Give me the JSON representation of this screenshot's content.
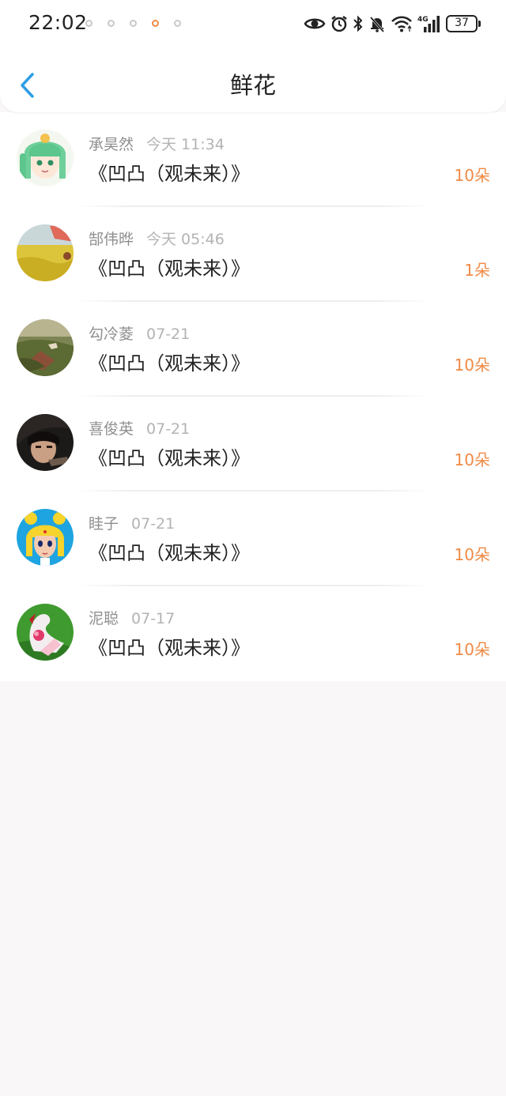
{
  "status_bar": {
    "time": "22:02",
    "battery": "37",
    "network": "4G"
  },
  "nav": {
    "title": "鲜花"
  },
  "items": [
    {
      "name": "承昊然",
      "time": "今天 11:34",
      "title": "《凹凸（观未来）》",
      "flowers": "10朵"
    },
    {
      "name": "郜伟晔",
      "time": "今天 05:46",
      "title": "《凹凸（观未来）》",
      "flowers": "1朵"
    },
    {
      "name": "勾冷菱",
      "time": "07-21",
      "title": "《凹凸（观未来）》",
      "flowers": "10朵"
    },
    {
      "name": "喜俊英",
      "time": "07-21",
      "title": "《凹凸（观未来）》",
      "flowers": "10朵"
    },
    {
      "name": "眭子",
      "time": "07-21",
      "title": "《凹凸（观未来）》",
      "flowers": "10朵"
    },
    {
      "name": "泥聪",
      "time": "07-17",
      "title": "《凹凸（观未来）》",
      "flowers": "10朵"
    }
  ],
  "colors": {
    "accent_orange": "#f08a45",
    "back_blue": "#2d9ee6",
    "muted_gray": "#8f8f8f",
    "time_gray": "#b3b3b3",
    "page_bg": "#f9f7f8"
  },
  "icons": [
    "back-icon",
    "eye-icon",
    "alarm-icon",
    "bluetooth-icon",
    "mute-bell-icon",
    "wifi-icon",
    "signal-icon",
    "battery-icon"
  ]
}
